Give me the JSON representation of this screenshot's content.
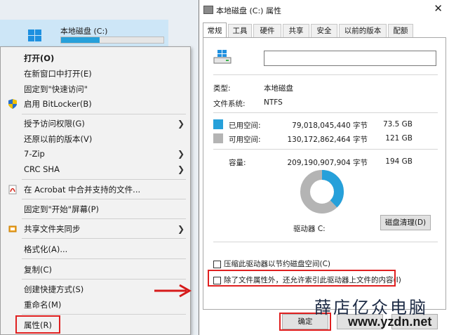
{
  "explorer": {
    "drive_label": "本地磁盘 (C:)",
    "used_fraction": 0.38,
    "accent": "#26a0da"
  },
  "context_menu": {
    "items": [
      {
        "label": "打开(O)"
      },
      {
        "label": "在新窗口中打开(E)"
      },
      {
        "label": "固定到\"快速访问\""
      },
      {
        "label": "启用 BitLocker(B)",
        "icon": "shield-icon"
      },
      {
        "label": "授予访问权限(G)"
      },
      {
        "label": "还原以前的版本(V)"
      },
      {
        "label": "7-Zip"
      },
      {
        "label": "CRC SHA"
      },
      {
        "label": "在 Acrobat 中合并支持的文件...",
        "icon": "acrobat-icon"
      },
      {
        "label": "固定到\"开始\"屏幕(P)"
      },
      {
        "label": "共享文件夹同步",
        "icon": "sync-icon"
      },
      {
        "label": "格式化(A)..."
      },
      {
        "label": "复制(C)"
      },
      {
        "label": "创建快捷方式(S)"
      },
      {
        "label": "重命名(M)"
      },
      {
        "label": "属性(R)"
      }
    ]
  },
  "dialog": {
    "title": "本地磁盘 (C:) 属性",
    "tabs": [
      "常规",
      "工具",
      "硬件",
      "共享",
      "安全",
      "以前的版本",
      "配额"
    ],
    "name_value": "",
    "type_label": "类型:",
    "type_value": "本地磁盘",
    "fs_label": "文件系统:",
    "fs_value": "NTFS",
    "used": {
      "label": "已用空间:",
      "bytes": "79,018,045,440 字节",
      "size": "73.5 GB",
      "color": "#26a0da"
    },
    "free": {
      "label": "可用空间:",
      "bytes": "130,172,862,464 字节",
      "size": "121 GB",
      "color": "#b4b4b4"
    },
    "capacity": {
      "label": "容量:",
      "bytes": "209,190,907,904 字节",
      "size": "194 GB"
    },
    "drive_caption": "驱动器 C:",
    "cleanup_label": "磁盘清理(D)",
    "compress_label": "压缩此驱动器以节约磁盘空间(C)",
    "index_label": "除了文件属性外，还允许索引此驱动器上文件的内容(I)",
    "ok_label": "确定"
  },
  "watermark": {
    "cn": "薛店亿众电脑",
    "url": "www.yzdn.net"
  }
}
